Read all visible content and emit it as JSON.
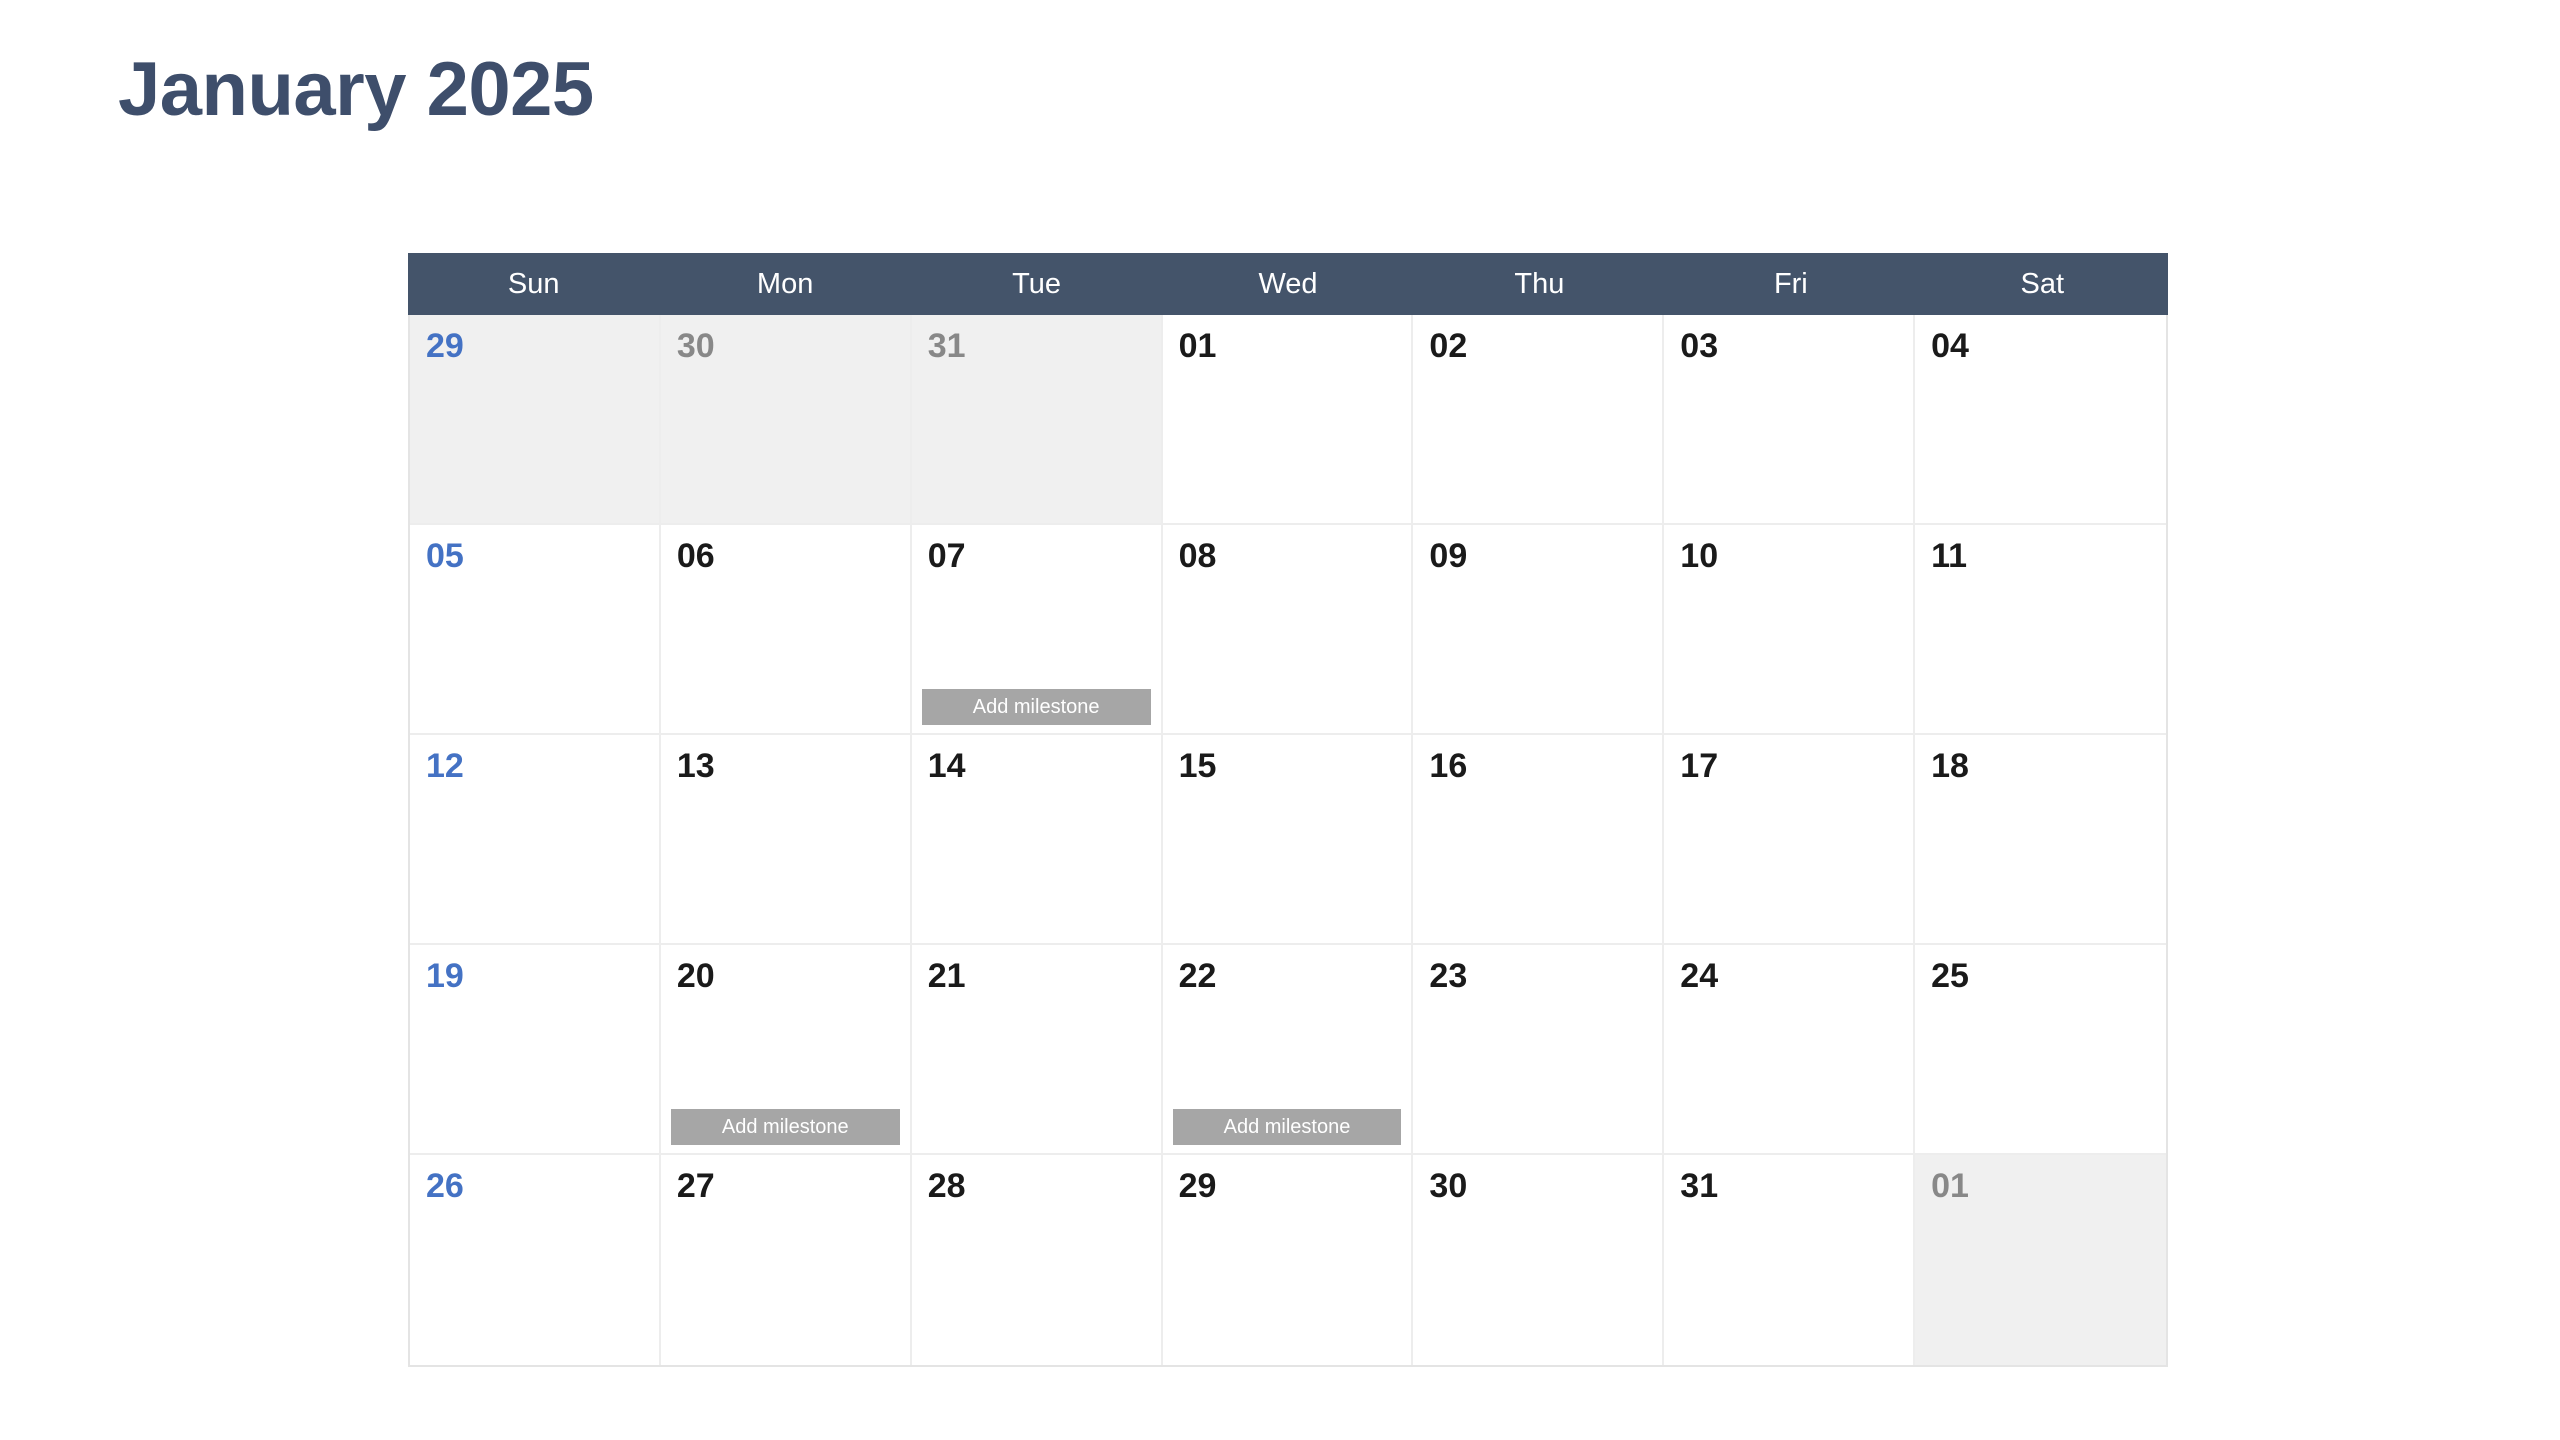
{
  "page_title": "January 2025",
  "colors": {
    "title": "#3E4E6B",
    "header_bg": "#44546A",
    "header_text": "#FFFFFF",
    "sunday_date": "#4472C4",
    "in_month_date": "#1A1A1A",
    "out_month_date": "#888888",
    "out_month_bg": "#F0F0F0",
    "milestone_bg": "#A6A6A6",
    "cell_border": "#EDEDED"
  },
  "weekday_headers": [
    "Sun",
    "Mon",
    "Tue",
    "Wed",
    "Thu",
    "Fri",
    "Sat"
  ],
  "milestone_label": "Add milestone",
  "weeks": [
    {
      "days": [
        {
          "label": "29",
          "in_month": false,
          "milestone": false
        },
        {
          "label": "30",
          "in_month": false,
          "milestone": false
        },
        {
          "label": "31",
          "in_month": false,
          "milestone": false
        },
        {
          "label": "01",
          "in_month": true,
          "milestone": false
        },
        {
          "label": "02",
          "in_month": true,
          "milestone": false
        },
        {
          "label": "03",
          "in_month": true,
          "milestone": false
        },
        {
          "label": "04",
          "in_month": true,
          "milestone": false
        }
      ]
    },
    {
      "days": [
        {
          "label": "05",
          "in_month": true,
          "milestone": false
        },
        {
          "label": "06",
          "in_month": true,
          "milestone": false
        },
        {
          "label": "07",
          "in_month": true,
          "milestone": true
        },
        {
          "label": "08",
          "in_month": true,
          "milestone": false
        },
        {
          "label": "09",
          "in_month": true,
          "milestone": false
        },
        {
          "label": "10",
          "in_month": true,
          "milestone": false
        },
        {
          "label": "11",
          "in_month": true,
          "milestone": false
        }
      ]
    },
    {
      "days": [
        {
          "label": "12",
          "in_month": true,
          "milestone": false
        },
        {
          "label": "13",
          "in_month": true,
          "milestone": false
        },
        {
          "label": "14",
          "in_month": true,
          "milestone": false
        },
        {
          "label": "15",
          "in_month": true,
          "milestone": false
        },
        {
          "label": "16",
          "in_month": true,
          "milestone": false
        },
        {
          "label": "17",
          "in_month": true,
          "milestone": false
        },
        {
          "label": "18",
          "in_month": true,
          "milestone": false
        }
      ]
    },
    {
      "days": [
        {
          "label": "19",
          "in_month": true,
          "milestone": false
        },
        {
          "label": "20",
          "in_month": true,
          "milestone": true
        },
        {
          "label": "21",
          "in_month": true,
          "milestone": false
        },
        {
          "label": "22",
          "in_month": true,
          "milestone": true
        },
        {
          "label": "23",
          "in_month": true,
          "milestone": false
        },
        {
          "label": "24",
          "in_month": true,
          "milestone": false
        },
        {
          "label": "25",
          "in_month": true,
          "milestone": false
        }
      ]
    },
    {
      "days": [
        {
          "label": "26",
          "in_month": true,
          "milestone": false
        },
        {
          "label": "27",
          "in_month": true,
          "milestone": false
        },
        {
          "label": "28",
          "in_month": true,
          "milestone": false
        },
        {
          "label": "29",
          "in_month": true,
          "milestone": false
        },
        {
          "label": "30",
          "in_month": true,
          "milestone": false
        },
        {
          "label": "31",
          "in_month": true,
          "milestone": false
        },
        {
          "label": "01",
          "in_month": false,
          "milestone": false
        }
      ]
    }
  ]
}
